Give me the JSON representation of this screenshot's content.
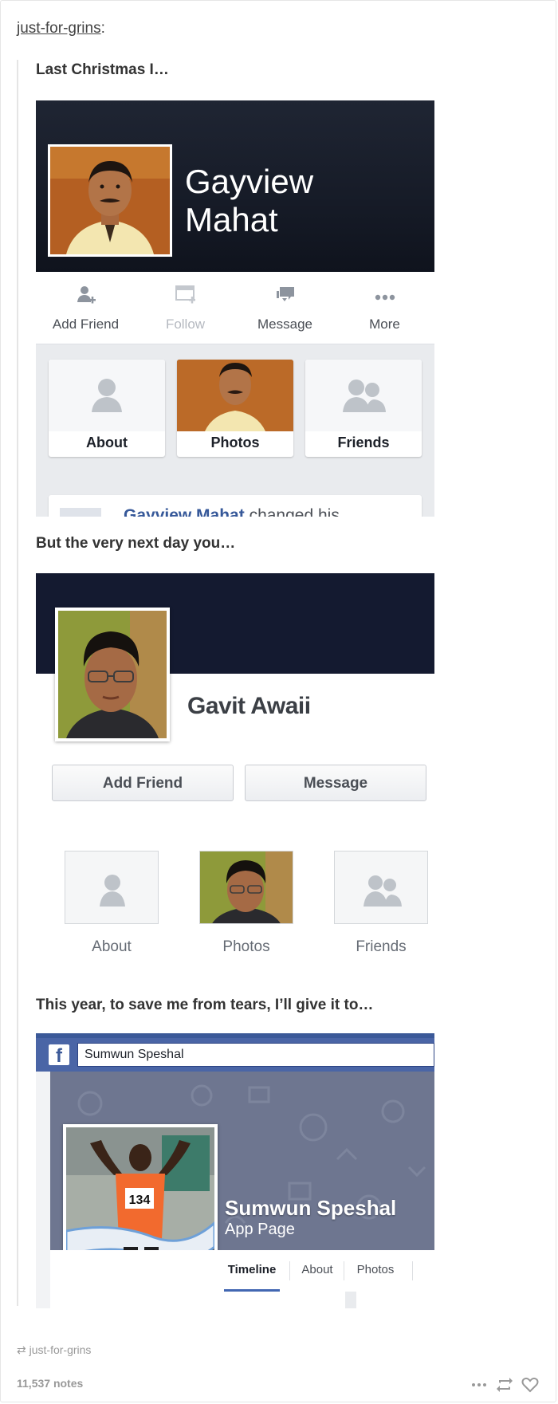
{
  "post": {
    "author": "just-for-grins",
    "author_suffix": ":",
    "captions": [
      "Last Christmas I…",
      "But the very next day you…",
      "This year, to save me from tears, I’ll give it to…"
    ]
  },
  "profile1": {
    "name_line1": "Gayview",
    "name_line2": "Mahat",
    "actions": [
      "Add Friend",
      "Follow",
      "Message",
      "More"
    ],
    "tiles": [
      "About",
      "Photos",
      "Friends"
    ],
    "story_name": "Gayview Mahat",
    "story_text": " changed his"
  },
  "profile2": {
    "name": "Gavit Awaii",
    "buttons": [
      "Add Friend",
      "Message"
    ],
    "tiles": [
      "About",
      "Photos",
      "Friends"
    ]
  },
  "profile3": {
    "search_value": "Sumwun Speshal",
    "fb_logo": "f",
    "name": "Sumwun Speshal",
    "subtitle": "App Page",
    "bib_number": "134",
    "tabs": [
      "Timeline",
      "About",
      "Photos"
    ]
  },
  "footer": {
    "source": "just-for-grins",
    "notes": "11,537 notes"
  },
  "colors": {
    "facebook_blue": "#3b5998",
    "cover_dark": "#141a30",
    "link_blue": "#365899"
  }
}
